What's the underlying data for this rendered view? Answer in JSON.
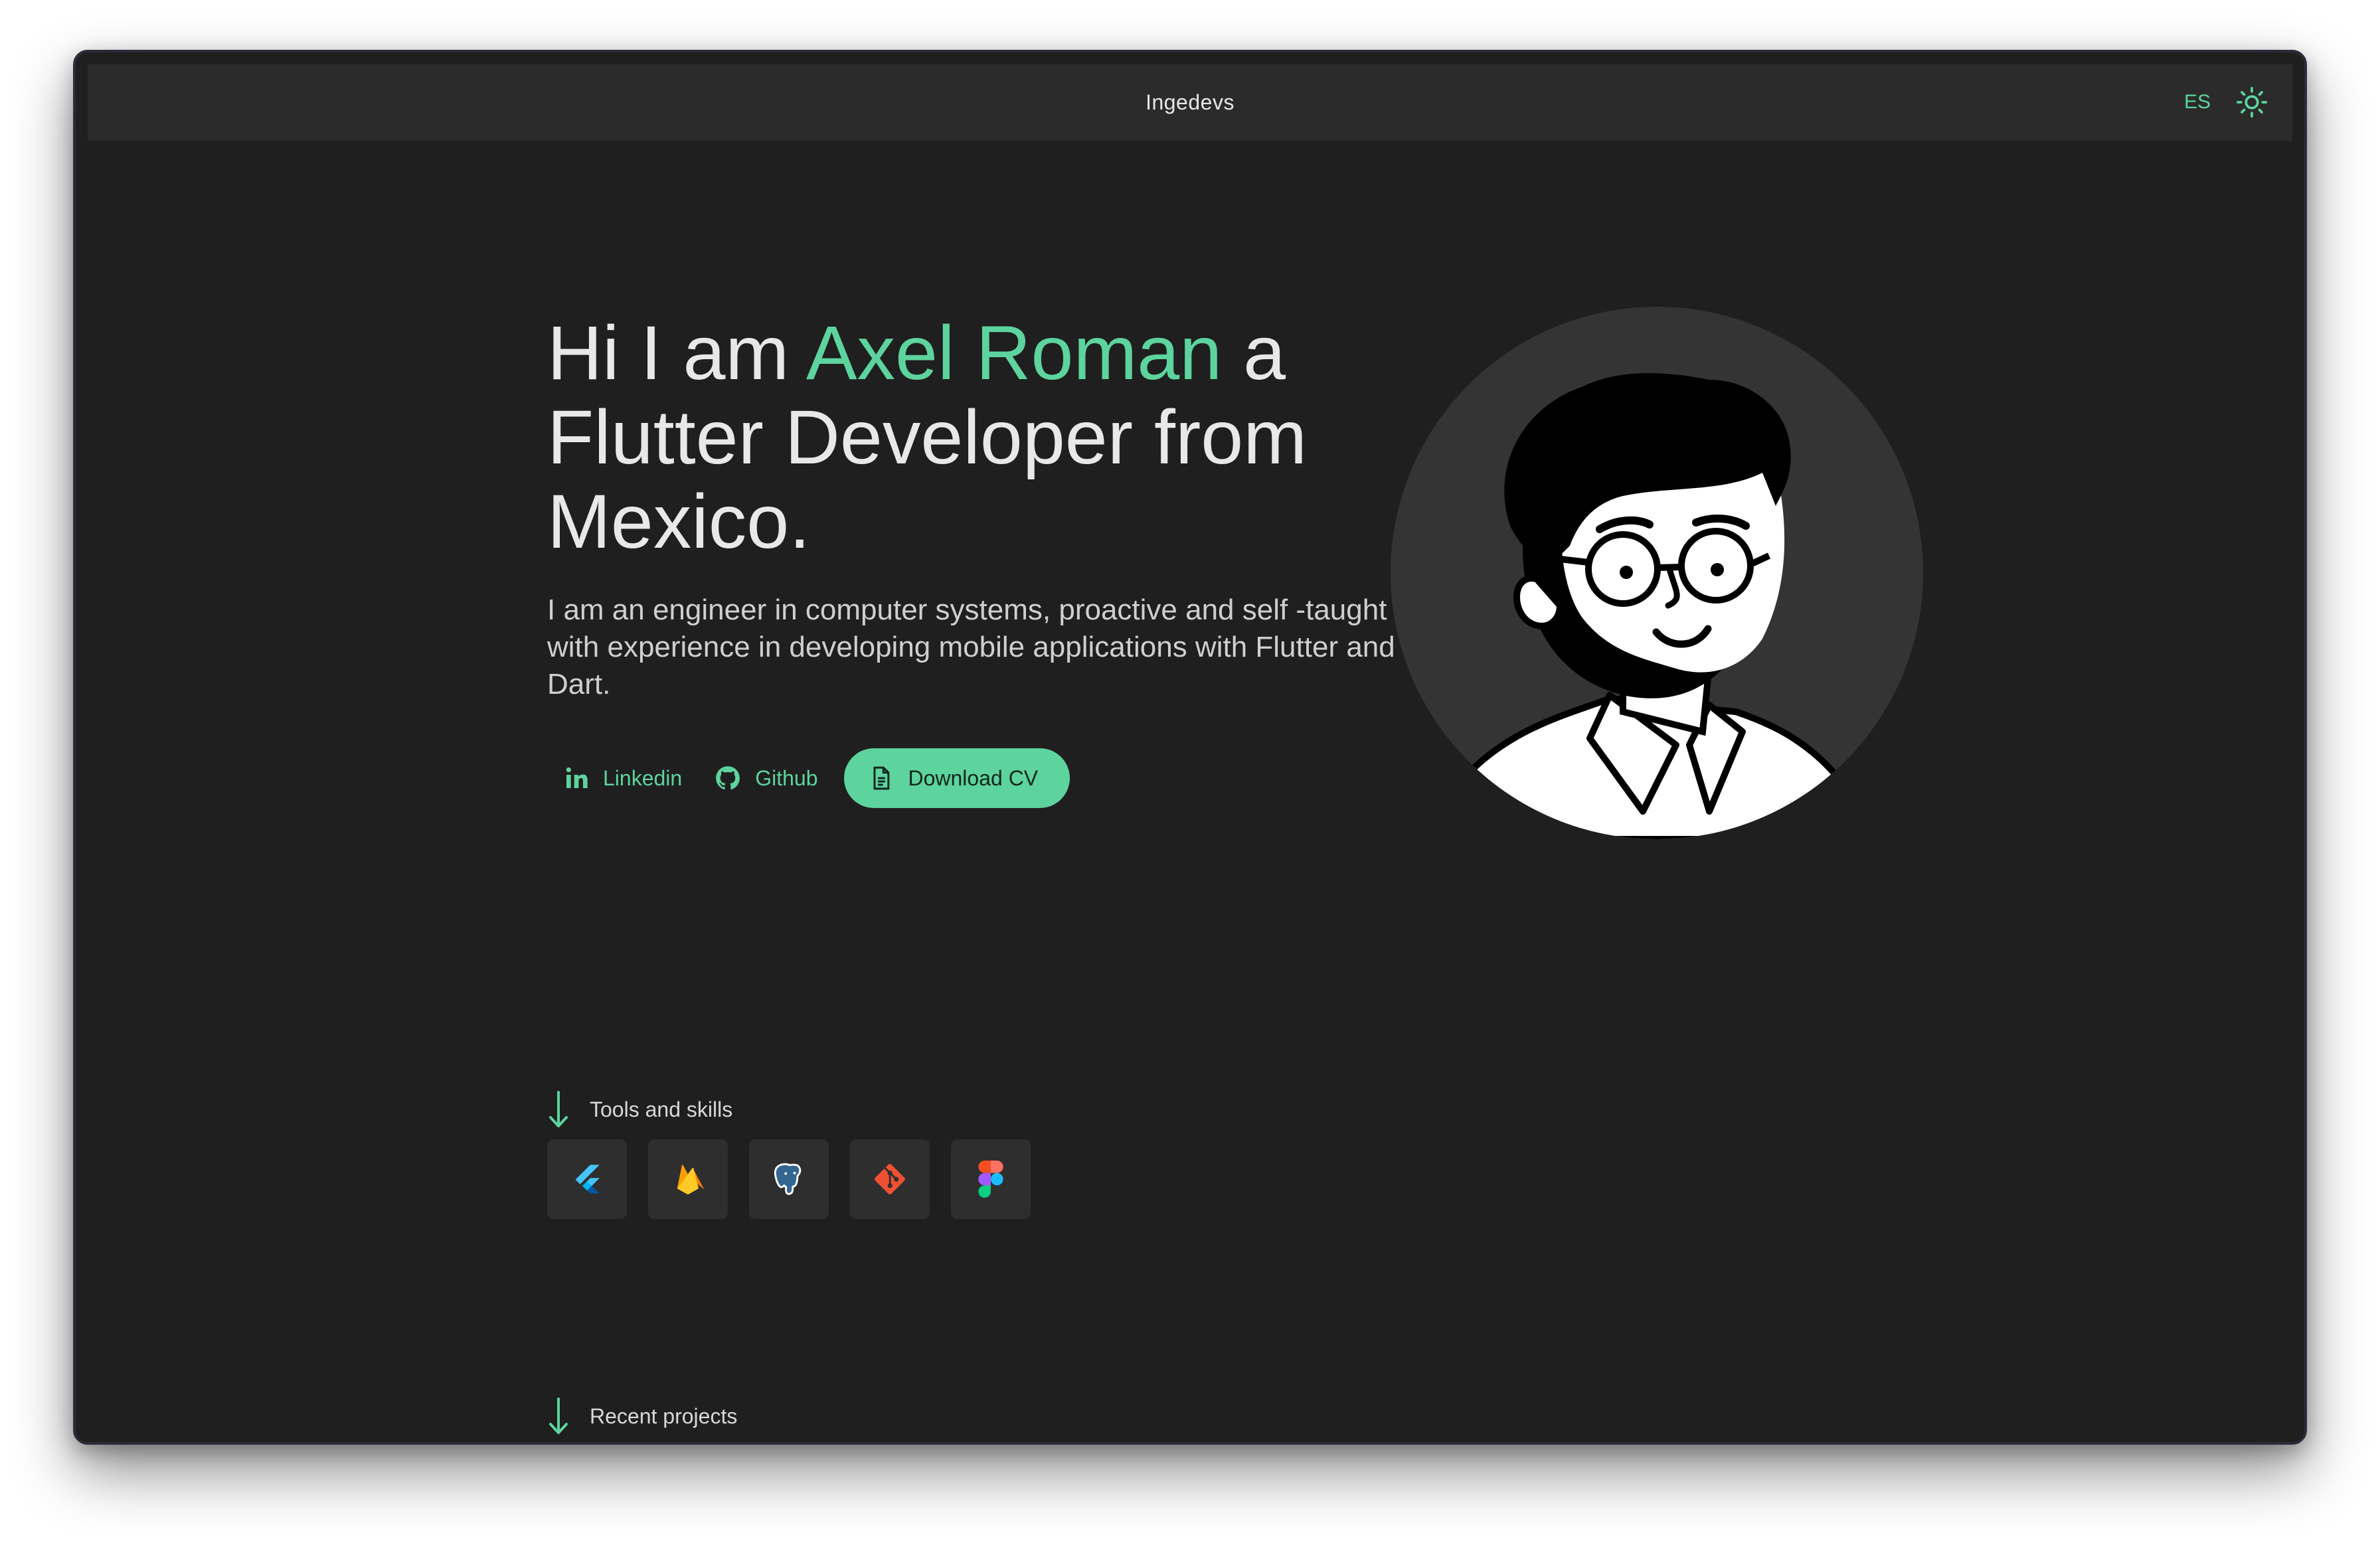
{
  "appbar": {
    "title": "Ingedevs",
    "lang_label": "ES",
    "theme_icon": "sun-icon"
  },
  "hero": {
    "greeting": "Hi I am ",
    "name": "Axel Roman",
    "tail": " a Flutter Developer from Mexico.",
    "description": "I am an engineer in computer systems, proactive and self -taught with experience in developing mobile applications with Flutter and Dart."
  },
  "actions": {
    "linkedin_label": "Linkedin",
    "github_label": "Github",
    "download_label": "Download CV"
  },
  "sections": {
    "skills_title": "Tools and skills",
    "projects_title": "Recent projects"
  },
  "skills": [
    {
      "icon": "flutter-icon"
    },
    {
      "icon": "firebase-icon"
    },
    {
      "icon": "postgresql-icon"
    },
    {
      "icon": "git-icon"
    },
    {
      "icon": "figma-icon"
    }
  ],
  "colors": {
    "accent": "#5dd39e",
    "background": "#1f1f1f",
    "appbar": "#2b2b2b",
    "avatar_bg": "#343434",
    "skill_tile": "#2e2e2e"
  }
}
